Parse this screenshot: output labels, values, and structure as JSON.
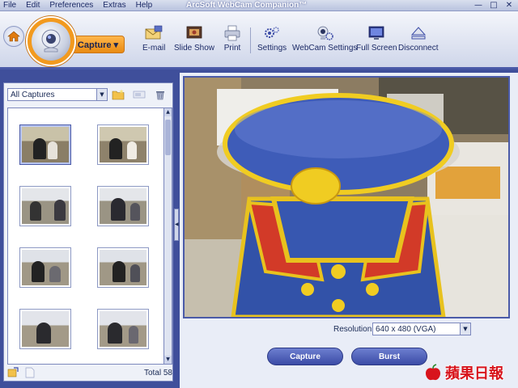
{
  "window": {
    "title": "ArcSoft WebCam Companion™",
    "menu": [
      "File",
      "Edit",
      "Preferences",
      "Extras",
      "Help"
    ],
    "controls": {
      "minimize": "—",
      "maximize": "□",
      "close": "✕"
    }
  },
  "toolbar": {
    "capture_tab": "Capture ▾",
    "buttons": [
      {
        "label": "E-mail",
        "icon": "email-icon"
      },
      {
        "label": "Slide Show",
        "icon": "slideshow-icon"
      },
      {
        "label": "Print",
        "icon": "printer-icon"
      },
      {
        "label": "Settings",
        "icon": "settings-icon"
      },
      {
        "label": "WebCam Settings",
        "icon": "webcam-settings-icon"
      },
      {
        "label": "Full Screen",
        "icon": "fullscreen-icon"
      },
      {
        "label": "Disconnect",
        "icon": "eject-icon"
      }
    ]
  },
  "left_panel": {
    "filter_value": "All Captures",
    "thumbnail_count": 8,
    "total_label": "Total 58"
  },
  "preview": {
    "resolution_label": "Resolution:",
    "resolution_value": "640 x 480 (VGA)"
  },
  "actions": {
    "capture": "Capture",
    "burst": "Burst"
  },
  "watermark": {
    "text": "蘋果日報"
  },
  "colors": {
    "frame": "#3f4f9b",
    "accent_orange": "#f29a1f",
    "button_blue": "#3b4ba6"
  }
}
